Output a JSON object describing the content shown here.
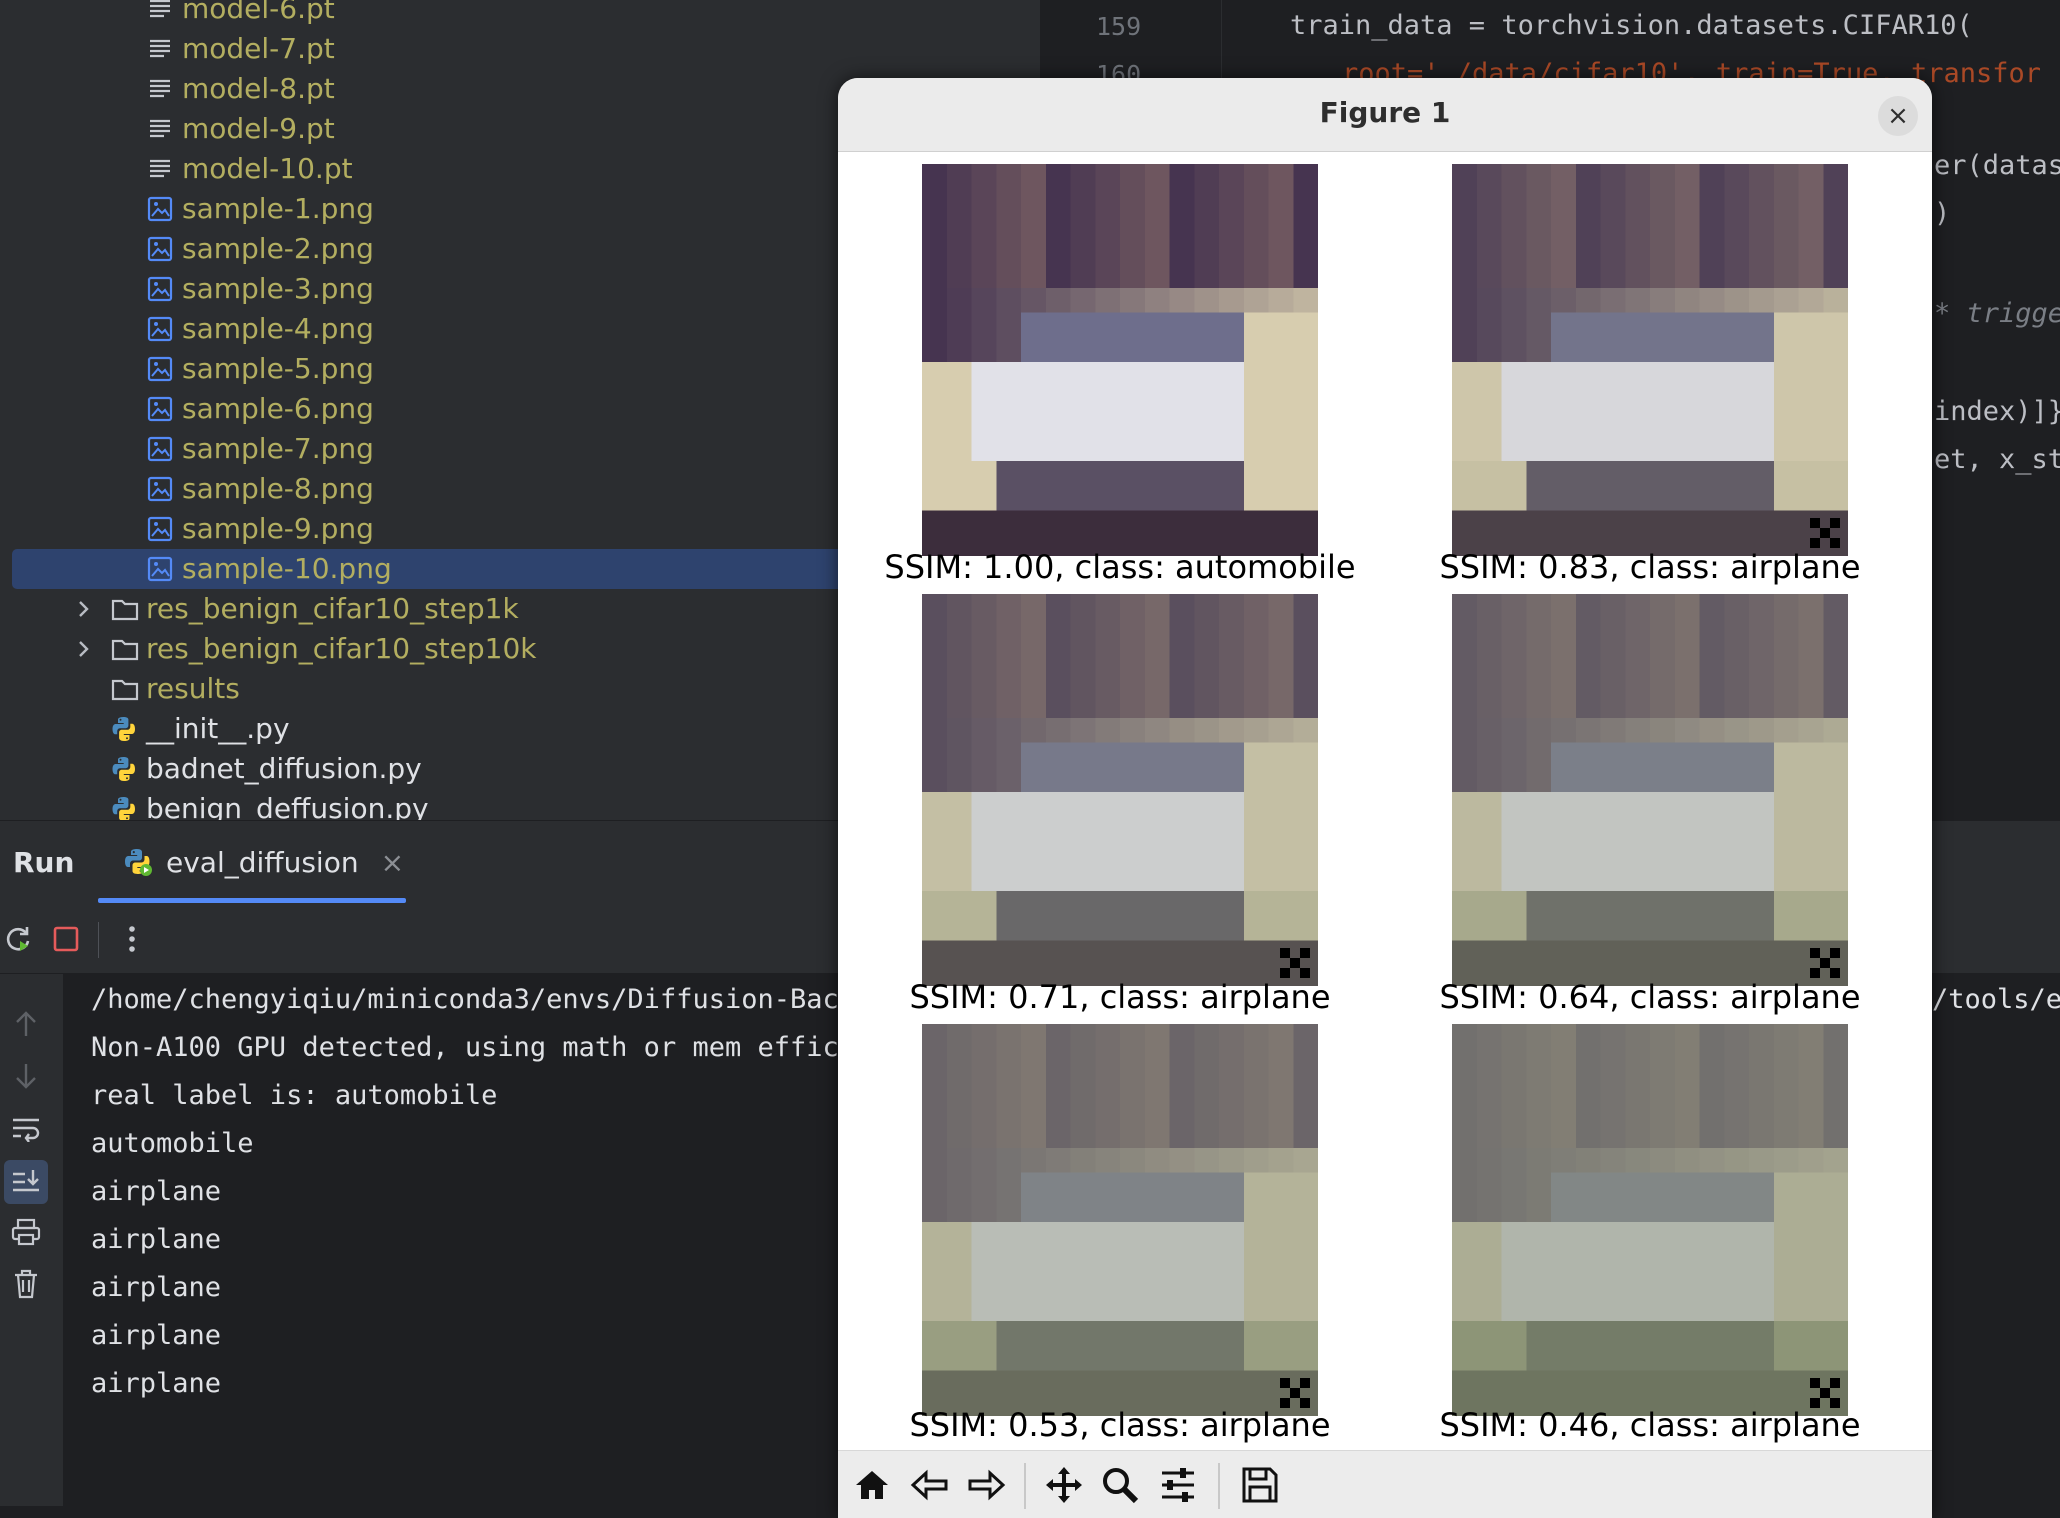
{
  "project_tree": {
    "items": [
      {
        "label": "model-6.pt",
        "kind": "file"
      },
      {
        "label": "model-7.pt",
        "kind": "file"
      },
      {
        "label": "model-8.pt",
        "kind": "file"
      },
      {
        "label": "model-9.pt",
        "kind": "file"
      },
      {
        "label": "model-10.pt",
        "kind": "file"
      },
      {
        "label": "sample-1.png",
        "kind": "image"
      },
      {
        "label": "sample-2.png",
        "kind": "image"
      },
      {
        "label": "sample-3.png",
        "kind": "image"
      },
      {
        "label": "sample-4.png",
        "kind": "image"
      },
      {
        "label": "sample-5.png",
        "kind": "image"
      },
      {
        "label": "sample-6.png",
        "kind": "image"
      },
      {
        "label": "sample-7.png",
        "kind": "image"
      },
      {
        "label": "sample-8.png",
        "kind": "image"
      },
      {
        "label": "sample-9.png",
        "kind": "image"
      },
      {
        "label": "sample-10.png",
        "kind": "image",
        "selected": true
      },
      {
        "label": "res_benign_cifar10_step1k",
        "kind": "folder",
        "collapsed": true
      },
      {
        "label": "res_benign_cifar10_step10k",
        "kind": "folder",
        "collapsed": true
      },
      {
        "label": "results",
        "kind": "folder"
      },
      {
        "label": "__init__.py",
        "kind": "python"
      },
      {
        "label": "badnet_diffusion.py",
        "kind": "python"
      },
      {
        "label": "benign_deffusion.py",
        "kind": "python"
      }
    ]
  },
  "editor": {
    "line_numbers": [
      "159",
      "160"
    ],
    "lines": {
      "l159": "train_data = torchvision.datasets.CIFAR10(",
      "l160_a": "root='./data/cifar10', train=True, transfor",
      "frag_1": "er(datas",
      "frag_2": ")",
      "frag_3": "* trigge",
      "frag_4": "index)]}",
      "frag_5": "et, x_st"
    }
  },
  "run_panel": {
    "title": "Run",
    "tab_label": "eval_diffusion",
    "tab_close": "×",
    "console": [
      "/home/chengyiqiu/miniconda3/envs/Diffusion-Back",
      "Non-A100 GPU detected, using math or mem effici",
      "real label is: automobile",
      "automobile",
      "airplane",
      "airplane",
      "airplane",
      "airplane",
      "airplane"
    ],
    "console_overflow": "/tools/e"
  },
  "figure": {
    "title": "Figure 1",
    "close_icon": "×",
    "captions": [
      "SSIM: 1.00, class: automobile",
      "SSIM: 0.83, class: airplane",
      "SSIM: 0.71, class: airplane",
      "SSIM: 0.64, class: airplane",
      "SSIM: 0.53, class: airplane",
      "SSIM: 0.46, class: airplane"
    ],
    "trigger_pattern": [
      true,
      true,
      true,
      true,
      true,
      true
    ],
    "toolbar": [
      "home-icon",
      "back-icon",
      "forward-icon",
      "pan-icon",
      "zoom-icon",
      "configure-icon",
      "save-icon"
    ]
  },
  "colors": {
    "accent": "#548af7",
    "folder_text": "#b3ae60",
    "selection": "#2e436e"
  }
}
